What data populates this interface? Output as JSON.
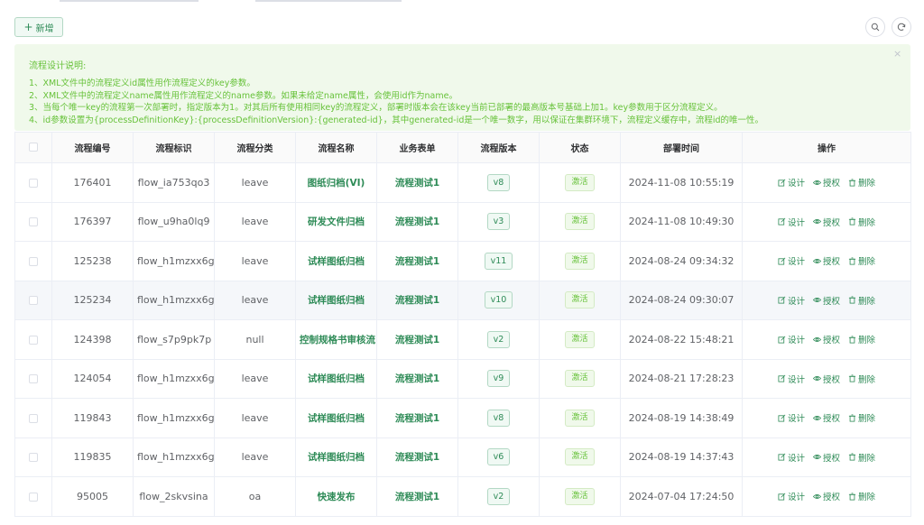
{
  "toolbar": {
    "add_label": "新增"
  },
  "notice": {
    "title": "流程设计说明:",
    "lines": [
      "1、XML文件中的流程定义id属性用作流程定义的key参数。",
      "2、XML文件中的流程定义name属性用作流程定义的name参数。如果未给定name属性，会使用id作为name。",
      "3、当每个唯一key的流程第一次部署时，指定版本为1。对其后所有使用相同key的流程定义，部署时版本会在该key当前已部署的最高版本号基础上加1。key参数用于区分流程定义。",
      "4、id参数设置为{processDefinitionKey}:{processDefinitionVersion}:{generated-id}，其中generated-id是一个唯一数字，用以保证在集群环境下，流程定义缓存中，流程id的唯一性。"
    ]
  },
  "table": {
    "headers": [
      "流程编号",
      "流程标识",
      "流程分类",
      "流程名称",
      "业务表单",
      "流程版本",
      "状态",
      "部署时间",
      "操作"
    ],
    "actions": {
      "design": "设计",
      "grant": "授权",
      "delete": "删除"
    },
    "rows": [
      {
        "id": "176401",
        "key": "flow_ia753qo3",
        "category": "leave",
        "name": "图纸归档(VI)",
        "form": "流程测试1",
        "version": "v8",
        "status": "激活",
        "time": "2024-11-08 10:55:19"
      },
      {
        "id": "176397",
        "key": "flow_u9ha0lq9",
        "category": "leave",
        "name": "研发文件归档",
        "form": "流程测试1",
        "version": "v3",
        "status": "激活",
        "time": "2024-11-08 10:49:30"
      },
      {
        "id": "125238",
        "key": "flow_h1mzxx6g",
        "category": "leave",
        "name": "试样图纸归档",
        "form": "流程测试1",
        "version": "v11",
        "status": "激活",
        "time": "2024-08-24 09:34:32"
      },
      {
        "id": "125234",
        "key": "flow_h1mzxx6g",
        "category": "leave",
        "name": "试样图纸归档",
        "form": "流程测试1",
        "version": "v10",
        "status": "激活",
        "time": "2024-08-24 09:30:07"
      },
      {
        "id": "124398",
        "key": "flow_s7p9pk7p",
        "category": "null",
        "name": "控制规格书审核流",
        "form": "流程测试1",
        "version": "v2",
        "status": "激活",
        "time": "2024-08-22 15:48:21"
      },
      {
        "id": "124054",
        "key": "flow_h1mzxx6g",
        "category": "leave",
        "name": "试样图纸归档",
        "form": "流程测试1",
        "version": "v9",
        "status": "激活",
        "time": "2024-08-21 17:28:23"
      },
      {
        "id": "119843",
        "key": "flow_h1mzxx6g",
        "category": "leave",
        "name": "试样图纸归档",
        "form": "流程测试1",
        "version": "v8",
        "status": "激活",
        "time": "2024-08-19 14:38:49"
      },
      {
        "id": "119835",
        "key": "flow_h1mzxx6g",
        "category": "leave",
        "name": "试样图纸归档",
        "form": "流程测试1",
        "version": "v6",
        "status": "激活",
        "time": "2024-08-19 14:37:43"
      },
      {
        "id": "95005",
        "key": "flow_2skvsina",
        "category": "oa",
        "name": "快速发布",
        "form": "流程测试1",
        "version": "v2",
        "status": "激活",
        "time": "2024-07-04 17:24:50"
      }
    ]
  }
}
